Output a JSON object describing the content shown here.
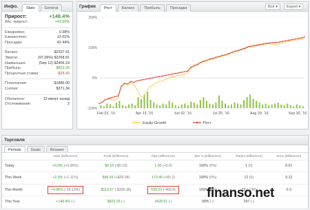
{
  "info": {
    "title": "Инфо.",
    "tabs": [
      "Stats",
      "General"
    ],
    "growth_label": "Прирост:",
    "growth_value": "+148.4%",
    "abs_label": "Абс. прирост:",
    "abs_value": "+43.65%",
    "group1": [
      {
        "k": "Ежедневно:",
        "v": "0.38%"
      },
      {
        "k": "Ежемесячно:",
        "v": "12.01%"
      },
      {
        "k": "Просадка:",
        "v": "42.44%"
      }
    ],
    "group2": [
      {
        "k": "Баланс:",
        "v": "$2337.91"
      },
      {
        "k": "Эквити:",
        "v": "(97.06%) $2268.91"
      },
      {
        "k": "Наивысшее:",
        "v": "(Sep 12) $2406.19"
      },
      {
        "k": "Прибыль:",
        "v": "$823.25"
      },
      {
        "k": "Процентная ставка:",
        "v": "-$15.42"
      }
    ],
    "group3": [
      {
        "k": "Пополнения:",
        "v": "$1886.00"
      },
      {
        "k": "Снятия:",
        "v": "$371.34"
      }
    ],
    "group4": [
      {
        "k": "Обновлено:",
        "v": "13 минут назад"
      },
      {
        "k": "Отслеживание:",
        "v": "2"
      }
    ]
  },
  "chart": {
    "title": "График",
    "tabs": [
      "Рост",
      "Баланс",
      "Прибыль",
      "Просадка"
    ],
    "range_select": "Всё",
    "export_label": "Export",
    "legend": [
      "Equity Growth",
      "Рост"
    ]
  },
  "chart_data": {
    "type": "line",
    "xlabel": "",
    "ylabel": "",
    "ylim": [
      -100,
      200
    ],
    "y_ticks": [
      "200%",
      "100%",
      "0%",
      "-100%"
    ],
    "x_ticks": [
      "Feb 03, '16",
      "Apr 13, '16",
      "Jun 02, '16",
      "Jul 20, '16",
      "Aug 29, '16",
      "Sep 30, '16"
    ],
    "series": [
      {
        "name": "Equity Growth",
        "color": "#f2c230",
        "values": [
          -85,
          -80,
          -72,
          -70,
          -68,
          -75,
          -65,
          -30,
          -20,
          -25,
          -15,
          -22,
          -40,
          -60,
          -65,
          -45,
          -30,
          -25,
          -18,
          -12,
          -10,
          -5,
          0,
          3,
          5,
          8,
          10,
          12,
          15,
          30,
          38,
          40,
          48,
          52,
          55,
          60,
          62,
          65,
          68,
          72,
          74,
          78,
          82,
          86,
          88,
          92,
          95,
          100,
          102,
          104,
          106,
          108,
          110,
          112,
          112,
          110,
          108,
          114,
          116,
          118,
          120,
          122,
          124,
          126,
          128,
          130
        ]
      },
      {
        "name": "Рост",
        "color": "#e03a2f",
        "values": [
          -85,
          -80,
          -72,
          -68,
          -65,
          -62,
          -60,
          -28,
          -18,
          -20,
          -12,
          -15,
          -10,
          -8,
          -6,
          -4,
          -2,
          0,
          2,
          4,
          6,
          8,
          10,
          12,
          14,
          16,
          18,
          20,
          22,
          35,
          40,
          44,
          50,
          55,
          58,
          62,
          64,
          68,
          70,
          74,
          76,
          80,
          84,
          88,
          90,
          94,
          97,
          102,
          104,
          106,
          108,
          110,
          112,
          114,
          115,
          116,
          117,
          118,
          120,
          122,
          124,
          126,
          128,
          130,
          132,
          135
        ]
      },
      {
        "name": "bars",
        "color": "#8cc63f",
        "values": [
          3,
          2,
          5,
          4,
          2,
          6,
          8,
          3,
          2,
          4,
          5,
          3,
          12,
          10,
          15,
          18,
          9,
          6,
          4,
          3,
          5,
          4,
          8,
          6,
          3,
          2,
          4,
          5,
          3,
          7,
          6,
          4,
          9,
          12,
          8,
          5,
          4,
          6,
          14,
          8,
          5,
          3,
          4,
          6,
          5,
          4,
          9,
          12,
          15,
          10,
          8,
          6,
          4,
          5,
          3,
          4,
          5,
          6,
          4,
          3,
          5,
          3,
          2,
          4,
          3,
          2
        ]
      }
    ]
  },
  "bottom": {
    "title": "Торговля",
    "tabs": [
      "Periods",
      "Goals",
      "Browser"
    ],
    "headers": [
      "Gain (Difference)",
      "Profit (Difference)",
      "Pips (Difference)",
      "Win % (Difference)",
      "Trades (Difference)",
      "Лоты (Difference)"
    ],
    "rows": [
      {
        "label": "Today",
        "gain": "+0.0%",
        "gain_d": "(+0.00%)",
        "profit": "$0.10",
        "profit_d": "(-$0.10)",
        "pips": "1.00",
        "pips_d": "(+0.0)",
        "win": "100%",
        "win_d": "(0%)",
        "trades": "1",
        "trades_d": "(0)",
        "lots": "0.01"
      },
      {
        "label": "This Week",
        "gain": "+2.0%",
        "gain_d": "(+1.11%)",
        "profit": "$45.93",
        "profit_d": "(+$25.04)",
        "pips": "173.40",
        "pips_d": "(+65.2)",
        "win": "100%",
        "win_d": "(0%)",
        "trades": "12",
        "trades_d": "(0)",
        "lots": "0.12"
      },
      {
        "label": "This Month",
        "gain": "+4.96%",
        "gain_d": "(-18.13%)",
        "profit": "$113.67",
        "profit_d": "(-$350.36)",
        "pips": "535.10",
        "pips_d": "(-409.4)",
        "win": "100%",
        "win_d": "(0%)",
        "trades": "32",
        "trades_d": "(-130)",
        "lots": "0.3"
      },
      {
        "label": "This Year",
        "gain": "+148.4%",
        "gain_d": "(-)",
        "profit": "$823.25",
        "profit_d": "(-)",
        "pips": "3428.51",
        "pips_d": "(-)",
        "win": "99%",
        "win_d": "(-)",
        "trades": "297",
        "trades_d": "(-)",
        "lots": ""
      }
    ]
  },
  "watermark": "finanso.net"
}
